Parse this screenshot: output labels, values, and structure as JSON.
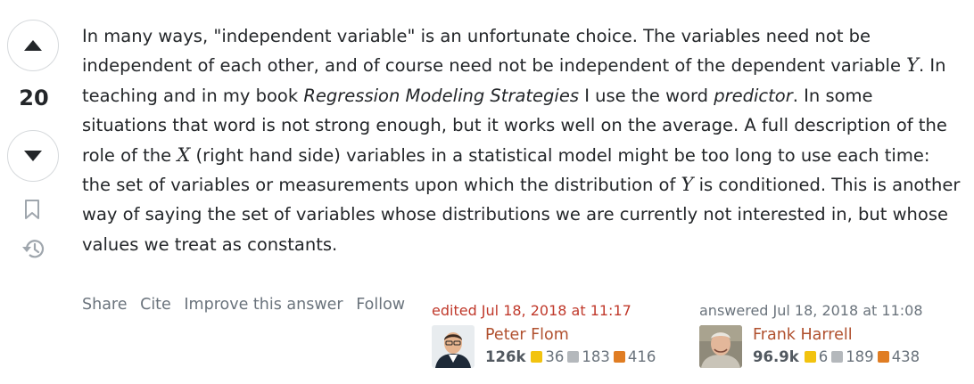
{
  "votes": {
    "count": "20",
    "upvote_icon": "triangle-up-icon",
    "downvote_icon": "triangle-down-icon",
    "bookmark_icon": "bookmark-icon",
    "history_icon": "history-icon"
  },
  "answer": {
    "p1": "In many ways, \"independent variable\" is an unfortunate choice. The variables need not be independent of each other, and of course need not be independent of the dependent variable ",
    "y1": "Y",
    "p2": ". In teaching and in my book ",
    "book_title": "Regression Modeling Strategies",
    "p3": " I use the word ",
    "word": "predictor",
    "p4": ". In some situations that word is not strong enough, but it works well on the average. A full description of the role of the ",
    "x1": "X",
    "p5": " (right hand side) variables in a statistical model might be too long to use each time: the set of variables or measurements upon which the distribution of ",
    "y2": "Y",
    "p6": " is conditioned. This is another way of saying the set of variables whose distributions we are currently not interested in, but whose values we treat as constants."
  },
  "menu": {
    "share": "Share",
    "cite": "Cite",
    "improve": "Improve this answer",
    "follow": "Follow"
  },
  "edited": {
    "action": "edited Jul 18, 2018 at 11:17",
    "name": "Peter Flom",
    "rep": "126k",
    "gold": "36",
    "silver": "183",
    "bronze": "416"
  },
  "answered": {
    "action": "answered Jul 18, 2018 at 11:08",
    "name": "Frank Harrell",
    "rep": "96.9k",
    "gold": "6",
    "silver": "189",
    "bronze": "438"
  },
  "colors": {
    "text": "#232629",
    "muted": "#6a737c",
    "user_link": "#b0502e",
    "gold": "#f2c30f",
    "silver": "#b4b8bc",
    "bronze": "#e07d23"
  }
}
